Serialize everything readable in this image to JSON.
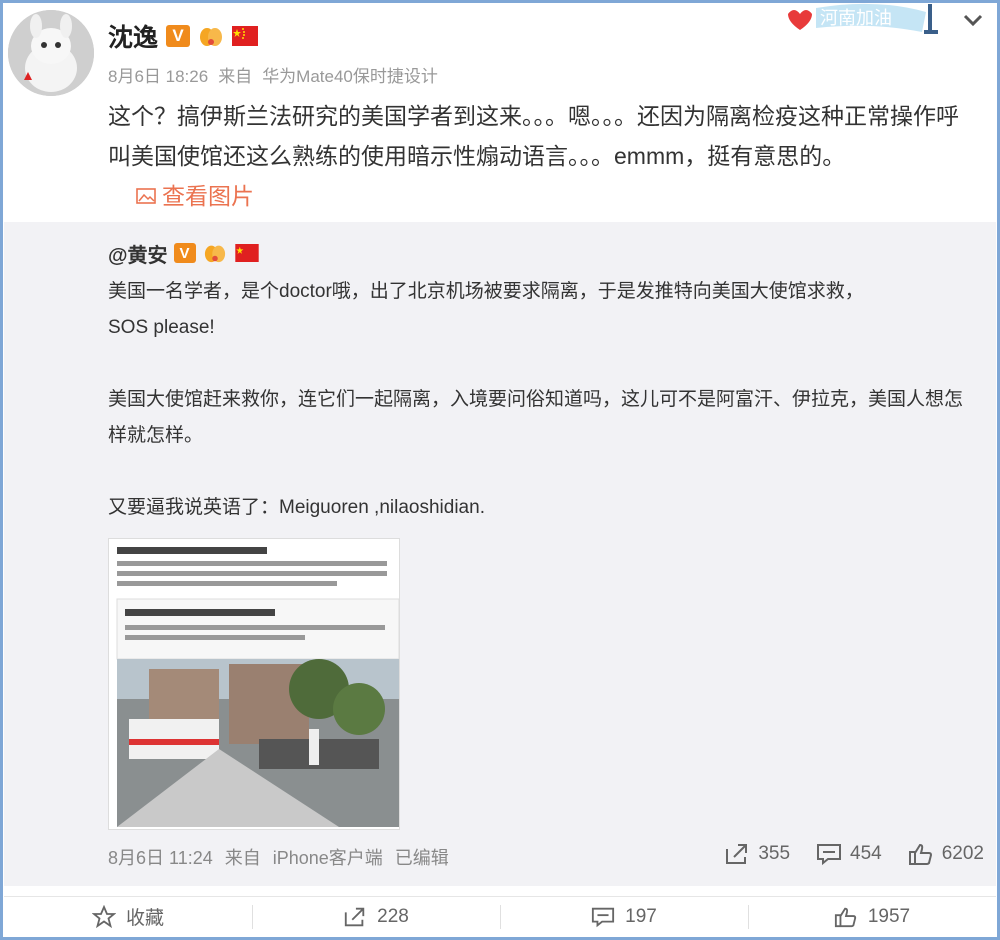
{
  "post": {
    "author": "沈逸",
    "meta": {
      "date": "8月6日 18:26",
      "source_prefix": "来自",
      "source": "华为Mate40保时捷设计"
    },
    "text": "这个？搞伊斯兰法研究的美国学者到这来。。。嗯。。。还因为隔离检疫这种正常操作呼叫美国使馆还这么熟练的使用暗示性煽动语言。。。emmm，挺有意思的。",
    "view_image_label": "查看图片",
    "header_deco_text": "河南加油"
  },
  "repost": {
    "author": "@黄安",
    "paragraphs": [
      "美国一名学者，是个doctor哦，出了北京机场被要求隔离，于是发推特向美国大使馆求救，",
      "SOS please!",
      "美国大使馆赶来救你，连它们一起隔离，入境要问俗知道吗，这儿可不是阿富汗、伊拉克，美国人想怎样就怎样。",
      "又要逼我说英语了：Meiguoren ,nilaoshidian."
    ],
    "meta": {
      "date": "8月6日 11:24",
      "source_prefix": "来自",
      "source": "iPhone客户端",
      "edited": "已编辑"
    },
    "stats": {
      "reposts": "355",
      "comments": "454",
      "likes": "6202"
    }
  },
  "footer": {
    "favorite_label": "收藏",
    "repost_count": "228",
    "comment_count": "197",
    "like_count": "1957"
  },
  "colors": {
    "accent_link": "#eb7350",
    "badge_orange": "#f08b1c",
    "flag_red": "#e02020",
    "repost_bg": "#f2f2f5",
    "frame_border": "#7fa7d6"
  }
}
